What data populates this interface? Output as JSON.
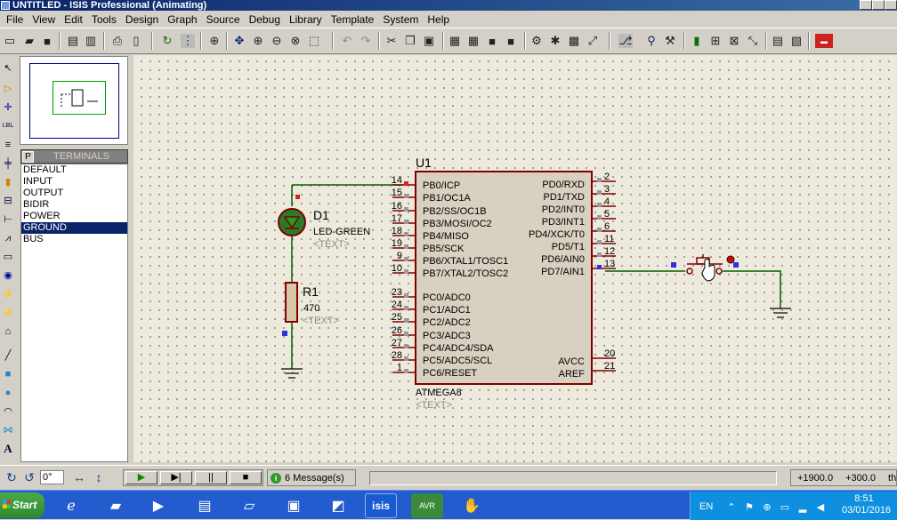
{
  "window": {
    "title": "UNTITLED - ISIS Professional (Animating)"
  },
  "menu": [
    "File",
    "View",
    "Edit",
    "Tools",
    "Design",
    "Graph",
    "Source",
    "Debug",
    "Library",
    "Template",
    "System",
    "Help"
  ],
  "terminals": {
    "tab": "P",
    "title": "TERMINALS",
    "items": [
      "DEFAULT",
      "INPUT",
      "OUTPUT",
      "BIDIR",
      "POWER",
      "GROUND",
      "BUS"
    ],
    "selected": "GROUND"
  },
  "schematic": {
    "chip": {
      "ref": "U1",
      "part": "ATMEGA8",
      "text": "<TEXT>",
      "left_pins": [
        {
          "num": "14",
          "name": "PB0/ICP"
        },
        {
          "num": "15",
          "name": "PB1/OC1A"
        },
        {
          "num": "16",
          "name": "PB2/SS/OC1B"
        },
        {
          "num": "17",
          "name": "PB3/MOSI/OC2"
        },
        {
          "num": "18",
          "name": "PB4/MISO"
        },
        {
          "num": "19",
          "name": "PB5/SCK"
        },
        {
          "num": "9",
          "name": "PB6/XTAL1/TOSC1"
        },
        {
          "num": "10",
          "name": "PB7/XTAL2/TOSC2"
        },
        {
          "num": "23",
          "name": "PC0/ADC0"
        },
        {
          "num": "24",
          "name": "PC1/ADC1"
        },
        {
          "num": "25",
          "name": "PC2/ADC2"
        },
        {
          "num": "26",
          "name": "PC3/ADC3"
        },
        {
          "num": "27",
          "name": "PC4/ADC4/SDA"
        },
        {
          "num": "28",
          "name": "PC5/ADC5/SCL"
        },
        {
          "num": "1",
          "name": "PC6/RESET"
        }
      ],
      "right_pins": [
        {
          "num": "2",
          "name": "PD0/RXD"
        },
        {
          "num": "3",
          "name": "PD1/TXD"
        },
        {
          "num": "4",
          "name": "PD2/INT0"
        },
        {
          "num": "5",
          "name": "PD3/INT1"
        },
        {
          "num": "6",
          "name": "PD4/XCK/T0"
        },
        {
          "num": "11",
          "name": "PD5/T1"
        },
        {
          "num": "12",
          "name": "PD6/AIN0"
        },
        {
          "num": "13",
          "name": "PD7/AIN1"
        },
        {
          "num": "20",
          "name": "AVCC"
        },
        {
          "num": "21",
          "name": "AREF"
        }
      ]
    },
    "led": {
      "ref": "D1",
      "part": "LED-GREEN",
      "text": "<TEXT>"
    },
    "resistor": {
      "ref": "R1",
      "value": "470",
      "text": "<TEXT>"
    }
  },
  "status": {
    "angle": "0°",
    "messages": "6 Message(s)",
    "x": "+1900.0",
    "y": "+300.0",
    "trailing": "th"
  },
  "taskbar": {
    "start": "Start",
    "language": "EN",
    "time": "8:51",
    "date": "03/01/2016"
  },
  "colors": {
    "canvas": "#ede9dc",
    "wire": "#006000",
    "component": "#800000",
    "chip_fill": "#d8d0c0",
    "selection": "#0a246a"
  }
}
